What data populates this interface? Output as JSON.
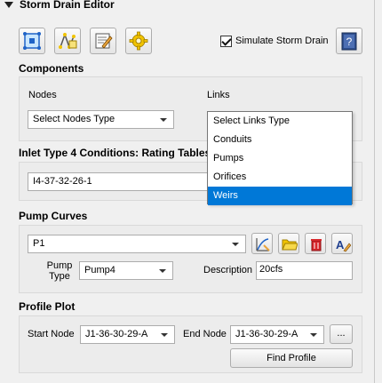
{
  "panel": {
    "title": "Storm Drain Editor"
  },
  "toolbar": {
    "buttons": [
      {
        "icon": "schematize-icon"
      },
      {
        "icon": "convert-layers-icon"
      },
      {
        "icon": "edit-table-icon"
      },
      {
        "icon": "settings-gear-icon"
      }
    ],
    "simulate_label": "Simulate Storm Drain",
    "simulate_checked": true,
    "help_icon": "help-book-icon"
  },
  "components": {
    "title": "Components",
    "nodes_label": "Nodes",
    "nodes_value": "Select Nodes Type",
    "links_label": "Links",
    "links_options": [
      "Select Links Type",
      "Conduits",
      "Pumps",
      "Orifices",
      "Weirs"
    ],
    "links_highlighted": "Weirs"
  },
  "inlet": {
    "title": "Inlet Type 4 Conditions: Rating Tables",
    "value": "I4-37-32-26-1"
  },
  "pump_curves": {
    "title": "Pump Curves",
    "curve_value": "P1",
    "pump_type_label": "Pump\nType",
    "pump_type_value": "Pump4",
    "description_label": "Description",
    "description_value": "20cfs",
    "buttons": [
      "add-curve-icon",
      "open-folder-icon",
      "delete-icon",
      "rename-icon"
    ]
  },
  "profile_plot": {
    "title": "Profile Plot",
    "start_label": "Start Node",
    "start_value": "J1-36-30-29-A",
    "end_label": "End Node",
    "end_value": "J1-36-30-29-A",
    "more_label": "...",
    "find_label": "Find Profile"
  },
  "colors": {
    "selection": "#0078d7",
    "gear": "#f2c400",
    "help": "#2f4f8f",
    "delete": "#d8262b"
  }
}
